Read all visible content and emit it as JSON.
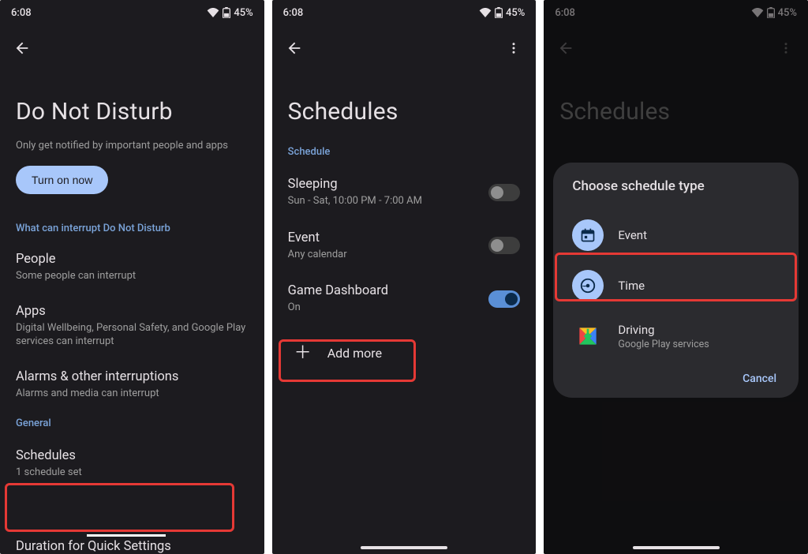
{
  "status": {
    "time": "6:08",
    "battery": "45%"
  },
  "screen1": {
    "title": "Do Not Disturb",
    "subtitle": "Only get notified by important people and apps",
    "turn_on": "Turn on now",
    "section_interrupt": "What can interrupt Do Not Disturb",
    "people": {
      "title": "People",
      "sub": "Some people can interrupt"
    },
    "apps": {
      "title": "Apps",
      "sub": "Digital Wellbeing, Personal Safety, and Google Play services can interrupt"
    },
    "alarms": {
      "title": "Alarms & other interruptions",
      "sub": "Alarms and media can interrupt"
    },
    "section_general": "General",
    "schedules": {
      "title": "Schedules",
      "sub": "1 schedule set"
    },
    "duration": "Duration for Quick Settings"
  },
  "screen2": {
    "title": "Schedules",
    "section": "Schedule",
    "sleeping": {
      "title": "Sleeping",
      "sub": "Sun - Sat, 10:00 PM - 7:00 AM",
      "on": false
    },
    "event": {
      "title": "Event",
      "sub": "Any calendar",
      "on": false
    },
    "game": {
      "title": "Game Dashboard",
      "sub": "On",
      "on": true
    },
    "add_more": "Add more"
  },
  "screen3": {
    "title": "Schedules",
    "dialog": {
      "heading": "Choose schedule type",
      "event": {
        "title": "Event"
      },
      "time": {
        "title": "Time"
      },
      "driving": {
        "title": "Driving",
        "sub": "Google Play services"
      },
      "cancel": "Cancel"
    }
  }
}
